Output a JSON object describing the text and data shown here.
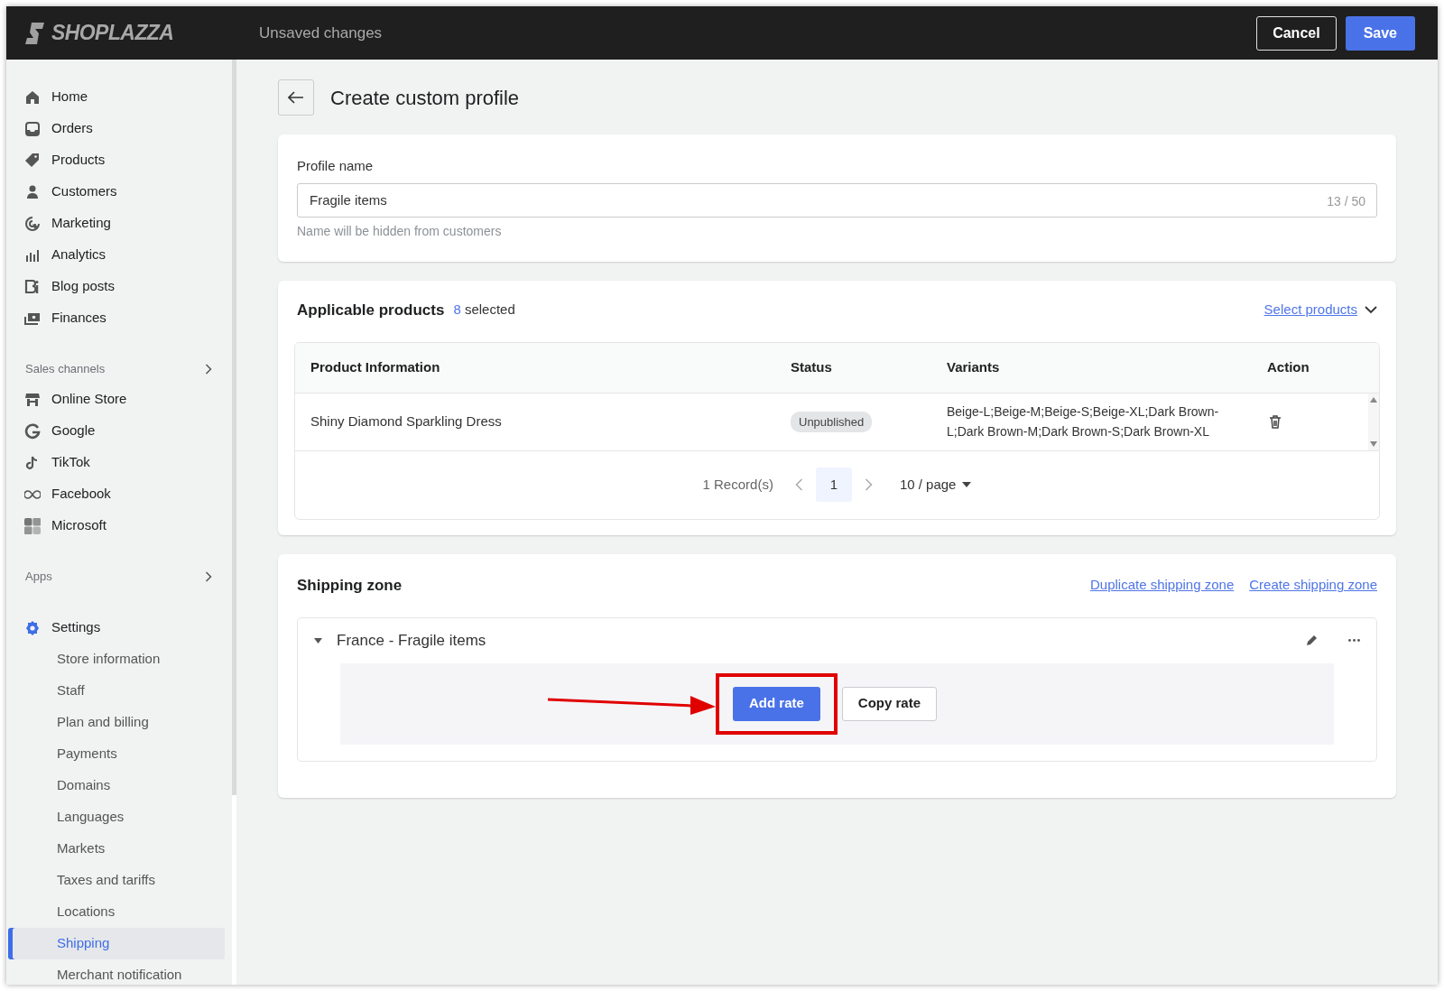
{
  "header": {
    "brand": "SHOPLAZZA",
    "status": "Unsaved changes",
    "buttons": [
      {
        "label": "Cancel",
        "kind": "secondary"
      },
      {
        "label": "Save",
        "kind": "primary"
      }
    ]
  },
  "sidebar": {
    "groups": [
      {
        "items": [
          {
            "label": "Home",
            "selected": false
          },
          {
            "label": "Orders",
            "selected": false
          },
          {
            "label": "Products",
            "selected": false
          },
          {
            "label": "Customers",
            "selected": false
          },
          {
            "label": "Marketing",
            "selected": false
          },
          {
            "label": "Analytics",
            "selected": false
          },
          {
            "label": "Blog posts",
            "selected": false
          },
          {
            "label": "Finances",
            "selected": false
          }
        ]
      },
      {
        "heading": "Sales channels",
        "items": [
          {
            "label": "Online Store",
            "selected": false
          },
          {
            "label": "Google",
            "selected": false
          },
          {
            "label": "TikTok",
            "selected": false
          },
          {
            "label": "Facebook",
            "selected": false
          },
          {
            "label": "Microsoft",
            "selected": false
          }
        ]
      },
      {
        "heading": "Apps"
      },
      {
        "items": [
          {
            "label": "Settings",
            "selected": true,
            "children": [
              {
                "label": "Store information",
                "selected": false
              },
              {
                "label": "Staff",
                "selected": false
              },
              {
                "label": "Plan and billing",
                "selected": false
              },
              {
                "label": "Payments",
                "selected": false
              },
              {
                "label": "Domains",
                "selected": false
              },
              {
                "label": "Languages",
                "selected": false
              },
              {
                "label": "Markets",
                "selected": false
              },
              {
                "label": "Taxes and tariffs",
                "selected": false
              },
              {
                "label": "Locations",
                "selected": false
              },
              {
                "label": "Shipping",
                "selected": true
              },
              {
                "label": "Merchant notification",
                "selected": false
              }
            ]
          }
        ]
      }
    ]
  },
  "page": {
    "title": "Create custom profile"
  },
  "profile_card": {
    "label": "Profile name",
    "value": "Fragile items",
    "counter": "13 / 50",
    "help": "Name will be hidden from customers"
  },
  "products_card": {
    "title": "Applicable products",
    "count": "8",
    "count_suffix": "selected",
    "link": "Select products",
    "table": {
      "columns": [
        "Product Information",
        "Status",
        "Variants",
        "Action"
      ],
      "rows": [
        {
          "product": "Shiny Diamond Sparkling Dress",
          "status": "Unpublished",
          "variants": "Beige-L;Beige-M;Beige-S;Beige-XL;Dark Brown-L;Dark Brown-M;Dark Brown-S;Dark Brown-XL"
        }
      ]
    },
    "pagination": {
      "summary": "1 Record(s)",
      "pages": [
        {
          "label": "1",
          "selected": true
        }
      ],
      "page_size": "10 / page"
    }
  },
  "shipping_card": {
    "title": "Shipping zone",
    "links": [
      "Duplicate shipping zone",
      "Create shipping zone"
    ],
    "zones": [
      {
        "name": "France - Fragile items",
        "expanded": true,
        "buttons": [
          {
            "label": "Add rate",
            "kind": "primary",
            "highlighted": true
          },
          {
            "label": "Copy rate",
            "kind": "secondary",
            "highlighted": false
          }
        ]
      }
    ]
  }
}
